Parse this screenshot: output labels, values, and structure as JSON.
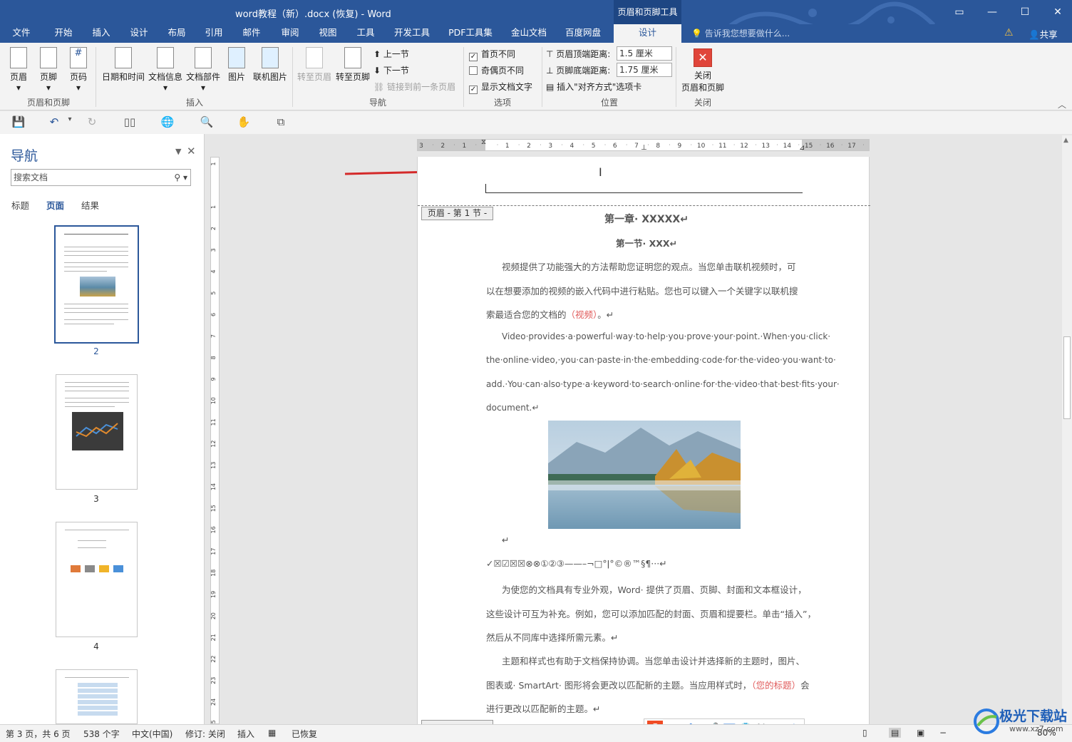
{
  "window": {
    "title": "word教程（新）.docx (恢复) - Word",
    "context_tab_group": "页眉和页脚工具",
    "accent": "#2b579a"
  },
  "tabs": [
    "文件",
    "开始",
    "插入",
    "设计",
    "布局",
    "引用",
    "邮件",
    "审阅",
    "视图",
    "工具",
    "开发工具",
    "PDF工具集",
    "金山文档",
    "百度网盘",
    "设计"
  ],
  "tell_me": "告诉我您想要做什么...",
  "share": "共享",
  "ribbon": {
    "groups": {
      "header_footer": "页眉和页脚",
      "insert": "插入",
      "navigation": "导航",
      "options": "选项",
      "position": "位置",
      "close": "关闭"
    },
    "buttons": {
      "header": "页眉",
      "footer": "页脚",
      "page_number": "页码",
      "date_time": "日期和时间",
      "doc_info": "文档信息",
      "doc_parts": "文档部件",
      "picture": "图片",
      "online_picture": "联机图片",
      "goto_header": "转至页眉",
      "goto_footer": "转至页脚",
      "prev_section": "上一节",
      "next_section": "下一节",
      "link_prev": "链接到前一条页眉",
      "close_1": "关闭",
      "close_2": "页眉和页脚"
    },
    "options": {
      "first_page_diff": {
        "label": "首页不同",
        "checked": true
      },
      "odd_even_diff": {
        "label": "奇偶页不同",
        "checked": false
      },
      "show_doc_text": {
        "label": "显示文档文字",
        "checked": true
      }
    },
    "position": {
      "header_top_label": "页眉顶端距离:",
      "header_top_value": "1.5 厘米",
      "footer_bottom_label": "页脚底端距离:",
      "footer_bottom_value": "1.75 厘米",
      "insert_align_tab": "插入\"对齐方式\"选项卡"
    }
  },
  "nav_pane": {
    "title": "导航",
    "search_placeholder": "搜索文档",
    "tabs": [
      "标题",
      "页面",
      "结果"
    ],
    "active_tab": "页面",
    "pages": [
      "2",
      "3",
      "4"
    ]
  },
  "document": {
    "header_tag": "页眉 - 第 1 节 -",
    "heading1": "第一章· XXXXX↵",
    "heading2": "第一节· XXX↵",
    "para1": [
      "视频提供了功能强大的方法帮助您证明您的观点。当您单击联机视频时，可",
      "以在想要添加的视频的嵌入代码中进行粘贴。您也可以键入一个关键字以联机搜",
      "索最适合您的文档的"
    ],
    "para1_red": "（视频）",
    "para1_end": "。↵",
    "para2": [
      "Video·provides·a·powerful·way·to·help·you·prove·your·point.·When·you·click·",
      "the·online·video,·you·can·paste·in·the·embedding·code·for·the·video·you·want·to·",
      "add.·You·can·also·type·a·keyword·to·search·online·for·the·video·that·best·fits·your·",
      "document.↵"
    ],
    "after_image": "↵",
    "symbols": "✓☒☑☒☒⊗⊗①②③——–¬□°ǀ°©®™§¶···↵",
    "para3": [
      "为使您的文档具有专业外观，Word· 提供了页眉、页脚、封面和文本框设计，",
      "这些设计可互为补充。例如，您可以添加匹配的封面、页眉和提要栏。单击“插入”，",
      "然后从不同库中选择所需元素。↵"
    ],
    "para4": [
      "主题和样式也有助于文档保持协调。当您单击设计并选择新的主题时，图片、",
      "图表或· SmartArt· 图形将会更改以匹配新的主题。当应用样式时，"
    ],
    "para4_red": "（您的标题）",
    "para4_tail": "会",
    "para4_last": "进行更改以匹配新的主题。↵"
  },
  "ruler": {
    "h_labels": [
      "3",
      "2",
      "1",
      "",
      "1",
      "2",
      "3",
      "4",
      "5",
      "6",
      "7",
      "8",
      "9",
      "10",
      "11",
      "12",
      "13",
      "14",
      "15",
      "16",
      "17"
    ],
    "v_labels": [
      "1",
      "",
      "1",
      "2",
      "3",
      "4",
      "5",
      "6",
      "7",
      "8",
      "9",
      "10",
      "11",
      "12",
      "13",
      "14",
      "15",
      "16",
      "17",
      "18",
      "19",
      "20",
      "21",
      "22",
      "23",
      "24",
      "25"
    ]
  },
  "status_bar": {
    "page": "第 3 页，共 6 页",
    "words": "538 个字",
    "language": "中文(中国)",
    "track": "修订: 关闭",
    "mode": "插入",
    "recovered": "已恢复",
    "zoom": "80%"
  },
  "ime": {
    "cn": "中",
    "punct": "°,"
  },
  "watermark": "极光下载站",
  "watermark_url": "www.xz7.com"
}
